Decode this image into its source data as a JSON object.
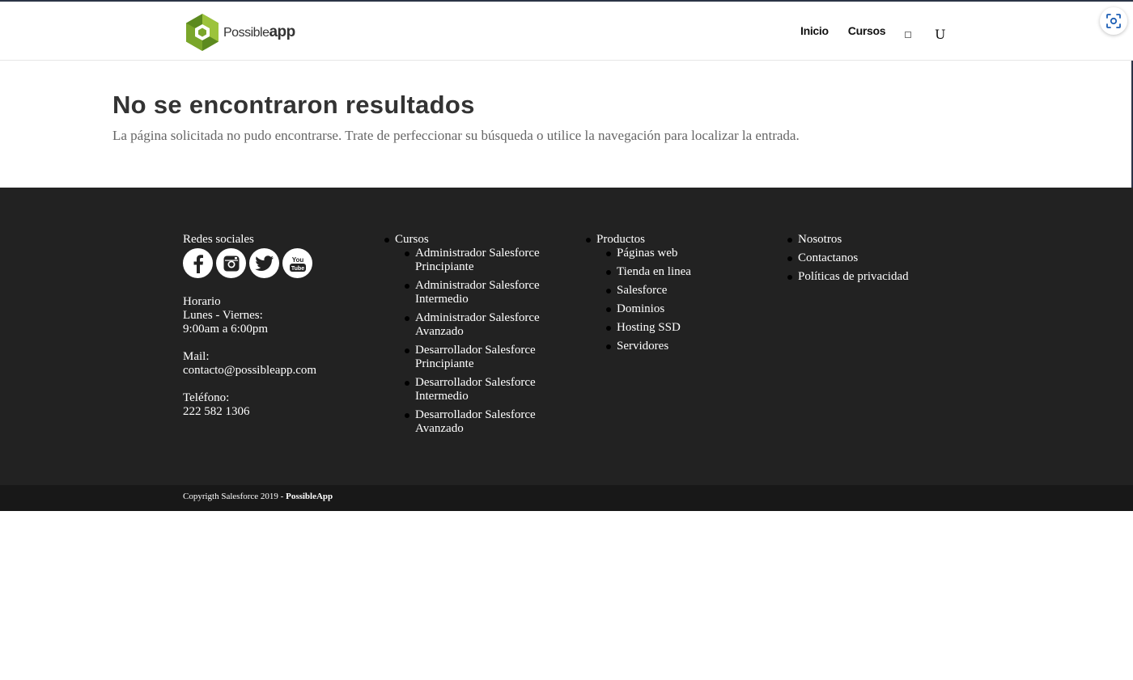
{
  "brand": {
    "word1": "Possible",
    "word2": "app",
    "colors": {
      "green_dark": "#5c8a1f",
      "green_light": "#9cc33c"
    }
  },
  "nav": {
    "items": [
      "Inicio",
      "Cursos"
    ],
    "icon_label": "U"
  },
  "main": {
    "title": "No se encontraron resultados",
    "message": "La página solicitada no pudo encontrarse. Trate de perfeccionar su búsqueda o utilice la navegación para localizar la entrada."
  },
  "footer": {
    "social_heading": "Redes sociales",
    "social_icons": [
      "facebook-icon",
      "instagram-icon",
      "twitter-icon",
      "youtube-icon"
    ],
    "schedule_heading": "Horario",
    "schedule_days": "Lunes - Viernes:",
    "schedule_hours": "9:00am a 6:00pm",
    "mail_label": "Mail:",
    "mail_value": "contacto@possibleapp.com",
    "phone_label": "Teléfono:",
    "phone_value": "222 582 1306",
    "courses": {
      "title": "Cursos",
      "items": [
        "Administrador Salesforce Principiante",
        "Administrador Salesforce Intermedio",
        "Administrador Salesforce Avanzado",
        "Desarrollador Salesforce Principiante",
        "Desarrollador Salesforce Intermedio",
        "Desarrollador Salesforce Avanzado"
      ]
    },
    "products": {
      "title": "Productos",
      "items": [
        "Páginas web",
        "Tienda en linea",
        "Salesforce",
        "Dominios",
        "Hosting SSD",
        "Servidores"
      ]
    },
    "company": [
      "Nosotros",
      "Contactanos",
      "Políticas de privacidad"
    ]
  },
  "bottom": {
    "copyright_prefix": "Copyrigth Salesforce 2019 - ",
    "copyright_brand": "PossibleApp"
  },
  "colors": {
    "footer_bg": "#222222",
    "bottom_bg": "#181818",
    "title": "#333333",
    "text": "#666666"
  }
}
